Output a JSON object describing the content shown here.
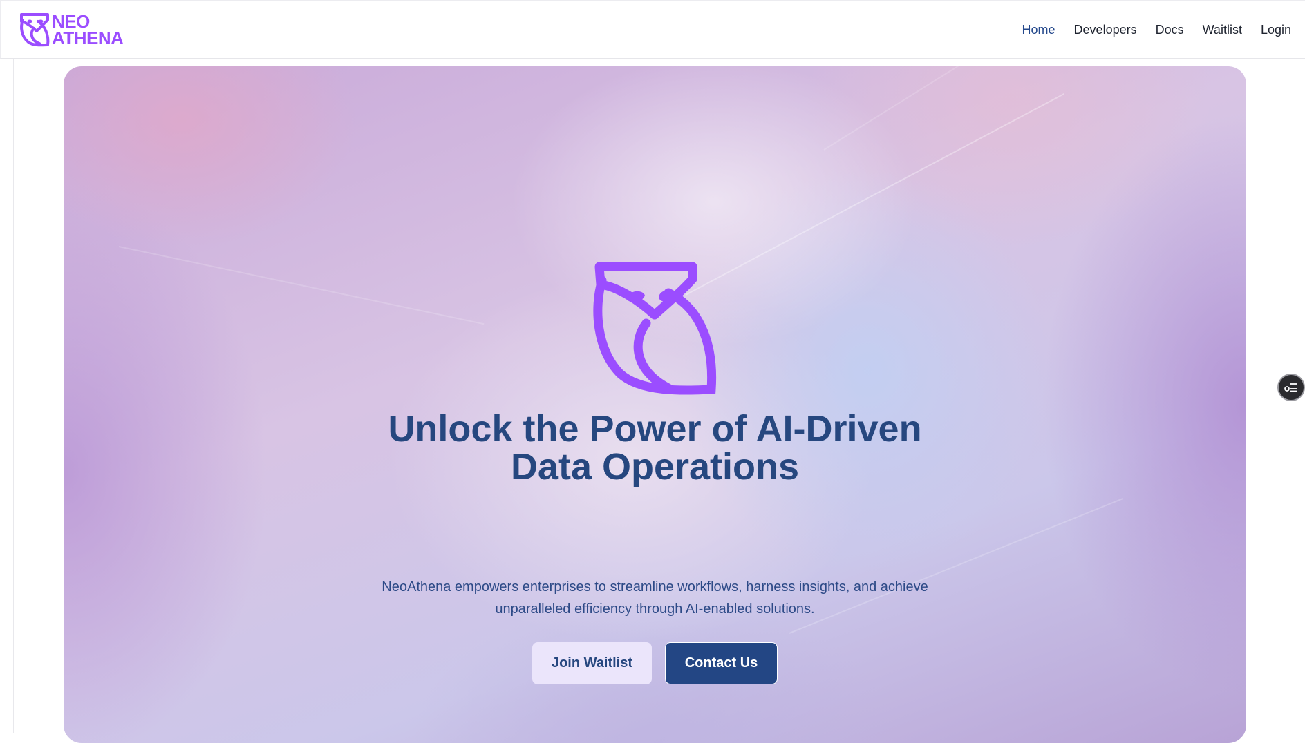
{
  "brand": {
    "logo_line1": "NEO",
    "logo_line2": "ATHENA",
    "color": "#9b4dff"
  },
  "nav": {
    "items": [
      {
        "label": "Home",
        "active": true
      },
      {
        "label": "Developers",
        "active": false
      },
      {
        "label": "Docs",
        "active": false
      },
      {
        "label": "Waitlist",
        "active": false
      },
      {
        "label": "Login",
        "active": false
      }
    ],
    "active_color": "#25498c"
  },
  "hero": {
    "icon": "owl-icon",
    "headline_line1": "Unlock the Power of AI-Driven",
    "headline_line2": "Data Operations",
    "subtitle_line1": "NeoAthena empowers enterprises to streamline workflows, harness insights, and achieve",
    "subtitle_line2": "unparalleled efficiency through AI-enabled solutions.",
    "cta_secondary": "Join Waitlist",
    "cta_primary": "Contact Us",
    "headline_color": "#26477f",
    "primary_button_color": "#234684"
  },
  "floating_widget": {
    "icon": "sliders-icon"
  }
}
